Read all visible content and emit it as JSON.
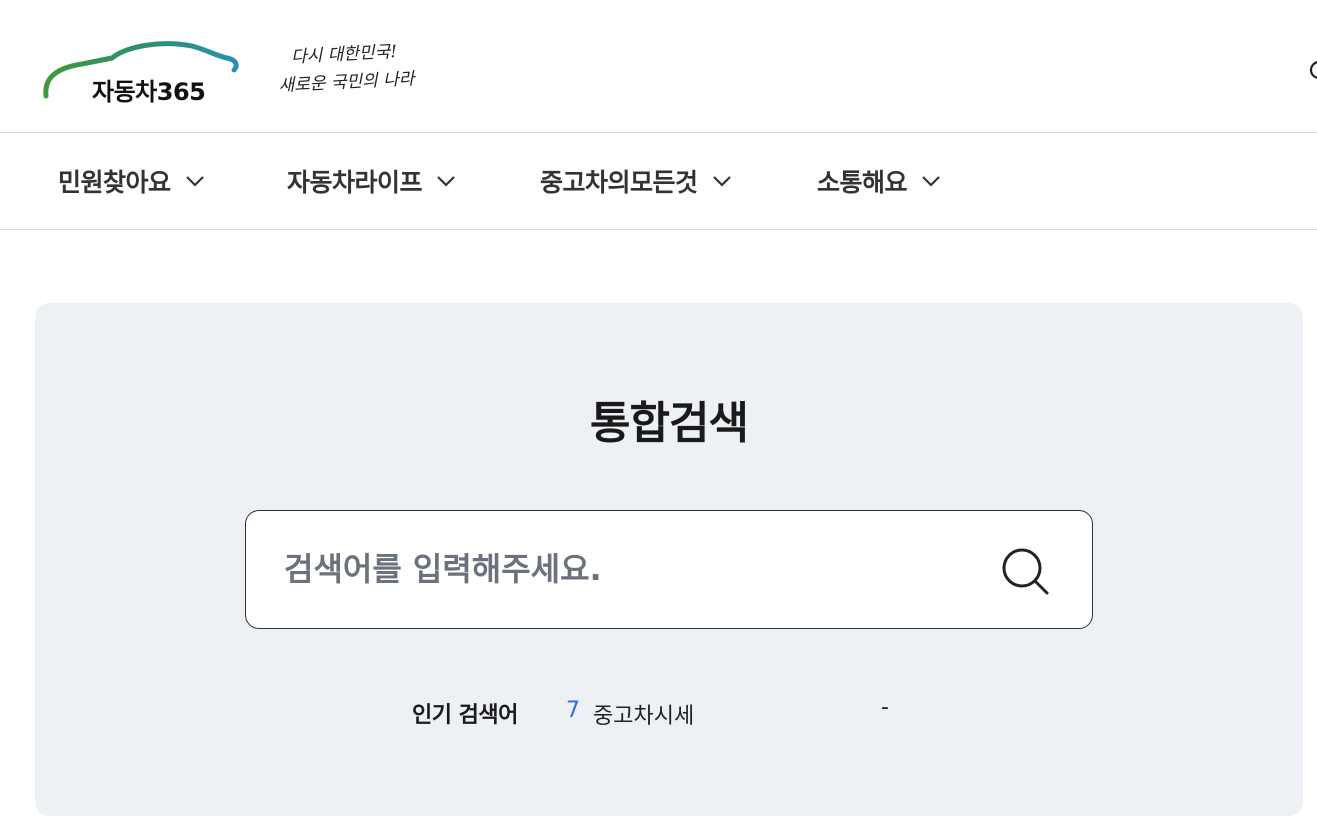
{
  "header": {
    "logo_text": "자동차365",
    "slogan_line1": "다시 대한민국!",
    "slogan_line2": "새로운 국민의 나라"
  },
  "nav": {
    "items": [
      {
        "label": "민원찾아요",
        "icon": "chevron-down-icon"
      },
      {
        "label": "자동차라이프",
        "icon": "chevron-down-icon"
      },
      {
        "label": "중고차의모든것",
        "icon": "chevron-down-icon"
      },
      {
        "label": "소통해요",
        "icon": "chevron-down-icon"
      }
    ]
  },
  "search": {
    "title": "통합검색",
    "placeholder": "검색어를 입력해주세요.",
    "value": "",
    "button_icon": "search-icon"
  },
  "popular": {
    "label": "인기 검색어",
    "rank": "7",
    "term": "중고차시세",
    "status": "-"
  },
  "colors": {
    "panel_bg": "#edf0f5",
    "rank_blue": "#2f6fe0",
    "logo_gradient_start": "#3d9a3a",
    "logo_gradient_end": "#2a8fb0"
  }
}
